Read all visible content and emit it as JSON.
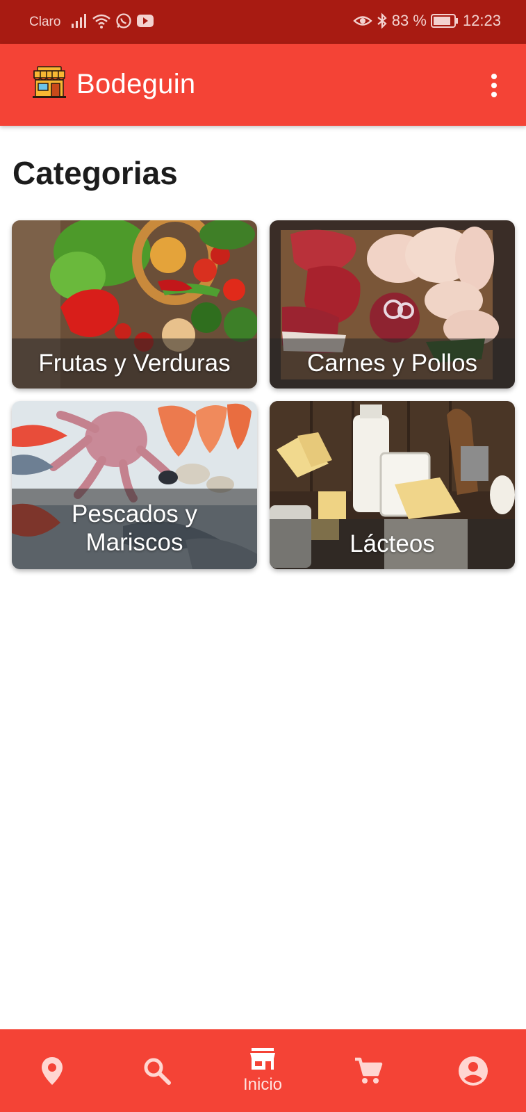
{
  "status_bar": {
    "carrier": "Claro",
    "battery": "83 %",
    "time": "12:23"
  },
  "app_bar": {
    "title": "Bodeguin",
    "logo_icon": "store-icon",
    "menu_icon": "more-vert-icon"
  },
  "page": {
    "title": "Categorias"
  },
  "categories": [
    {
      "label": "Frutas y Verduras"
    },
    {
      "label": "Carnes y Pollos"
    },
    {
      "label": "Pescados y Mariscos",
      "line1": "Pescados y",
      "line2": "Mariscos"
    },
    {
      "label": "Lácteos"
    }
  ],
  "bottom_nav": {
    "items": [
      {
        "icon": "location-pin-icon",
        "label": ""
      },
      {
        "icon": "search-icon",
        "label": ""
      },
      {
        "icon": "store-icon",
        "label": "Inicio"
      },
      {
        "icon": "cart-icon",
        "label": ""
      },
      {
        "icon": "account-icon",
        "label": ""
      }
    ]
  },
  "colors": {
    "primary": "#f44336",
    "status_bar": "#a81b12",
    "text_dark": "#1c1c1c"
  }
}
